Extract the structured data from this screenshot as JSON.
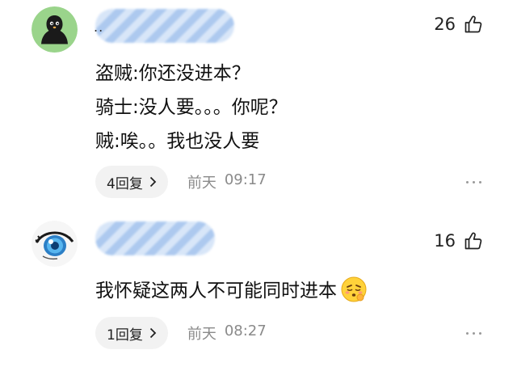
{
  "comments": [
    {
      "name_visible": "..",
      "likes": "26",
      "lines": [
        "盗贼:你还没进本？",
        "骑士:没人要。。。你呢？",
        "贼:唉。。我也没人要"
      ],
      "reply_label": "4回复",
      "time_day": "前天",
      "time_clock": "09:17"
    },
    {
      "likes": "16",
      "lines": [
        "我怀疑这两人不可能同时进本"
      ],
      "reply_label": "1回复",
      "time_day": "前天",
      "time_clock": "08:27"
    }
  ],
  "icons": {
    "like": "thumbs-up-icon",
    "reply_arrow": "chevron-right-icon",
    "more": "more-dots-icon",
    "avatar1": "black-blob-avatar",
    "avatar2": "anime-eye-avatar",
    "emoji": "face-emoji-icon"
  },
  "colors": {
    "avatar1_bg": "#9ad48b",
    "name_mask": "#a9c7ef",
    "reply_bg": "#f2f2f2",
    "time_text": "#8a8a8a"
  }
}
